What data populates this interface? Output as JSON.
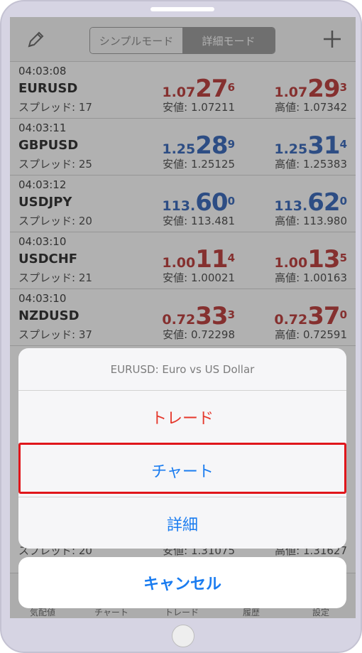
{
  "header": {
    "segments": [
      "シンプルモード",
      "詳細モード"
    ],
    "active_segment": 1
  },
  "quotes": [
    {
      "time": "04:03:08",
      "symbol": "EURUSD",
      "spread": "スプレッド: 17",
      "bid": {
        "p1": "1.07",
        "p2": "27",
        "p3": "6"
      },
      "ask": {
        "p1": "1.07",
        "p2": "29",
        "p3": "3"
      },
      "low": "安値: 1.07211",
      "high": "高値: 1.07342",
      "color": "#b3211f"
    },
    {
      "time": "04:03:11",
      "symbol": "GBPUSD",
      "spread": "スプレッド: 25",
      "bid": {
        "p1": "1.25",
        "p2": "28",
        "p3": "9"
      },
      "ask": {
        "p1": "1.25",
        "p2": "31",
        "p3": "4"
      },
      "low": "安値: 1.25125",
      "high": "高値: 1.25383",
      "color": "#1c54b2"
    },
    {
      "time": "04:03:12",
      "symbol": "USDJPY",
      "spread": "スプレッド: 20",
      "bid": {
        "p1": "113.",
        "p2": "60",
        "p3": "0"
      },
      "ask": {
        "p1": "113.",
        "p2": "62",
        "p3": "0"
      },
      "low": "安値: 113.481",
      "high": "高値: 113.980",
      "color": "#1c54b2"
    },
    {
      "time": "04:03:10",
      "symbol": "USDCHF",
      "spread": "スプレッド: 21",
      "bid": {
        "p1": "1.00",
        "p2": "11",
        "p3": "4"
      },
      "ask": {
        "p1": "1.00",
        "p2": "13",
        "p3": "5"
      },
      "low": "安値: 1.00021",
      "high": "高値: 1.00163",
      "color": "#b3211f"
    },
    {
      "time": "04:03:10",
      "symbol": "NZDUSD",
      "spread": "スプレッド: 37",
      "bid": {
        "p1": "0.72",
        "p2": "33",
        "p3": "3"
      },
      "ask": {
        "p1": "0.72",
        "p2": "37",
        "p3": "0"
      },
      "low": "安値: 0.72298",
      "high": "高値: 0.72591",
      "color": "#b3211f"
    }
  ],
  "partial_row": {
    "spread": "スプレッド: 20",
    "low": "安値: 1.31075",
    "high": "高値: 1.31627"
  },
  "tabs": [
    "気配値",
    "チャート",
    "トレード",
    "履歴",
    "設定"
  ],
  "sheet": {
    "title": "EURUSD: Euro vs US Dollar",
    "trade": "トレード",
    "chart": "チャート",
    "details": "詳細",
    "cancel": "キャンセル"
  }
}
